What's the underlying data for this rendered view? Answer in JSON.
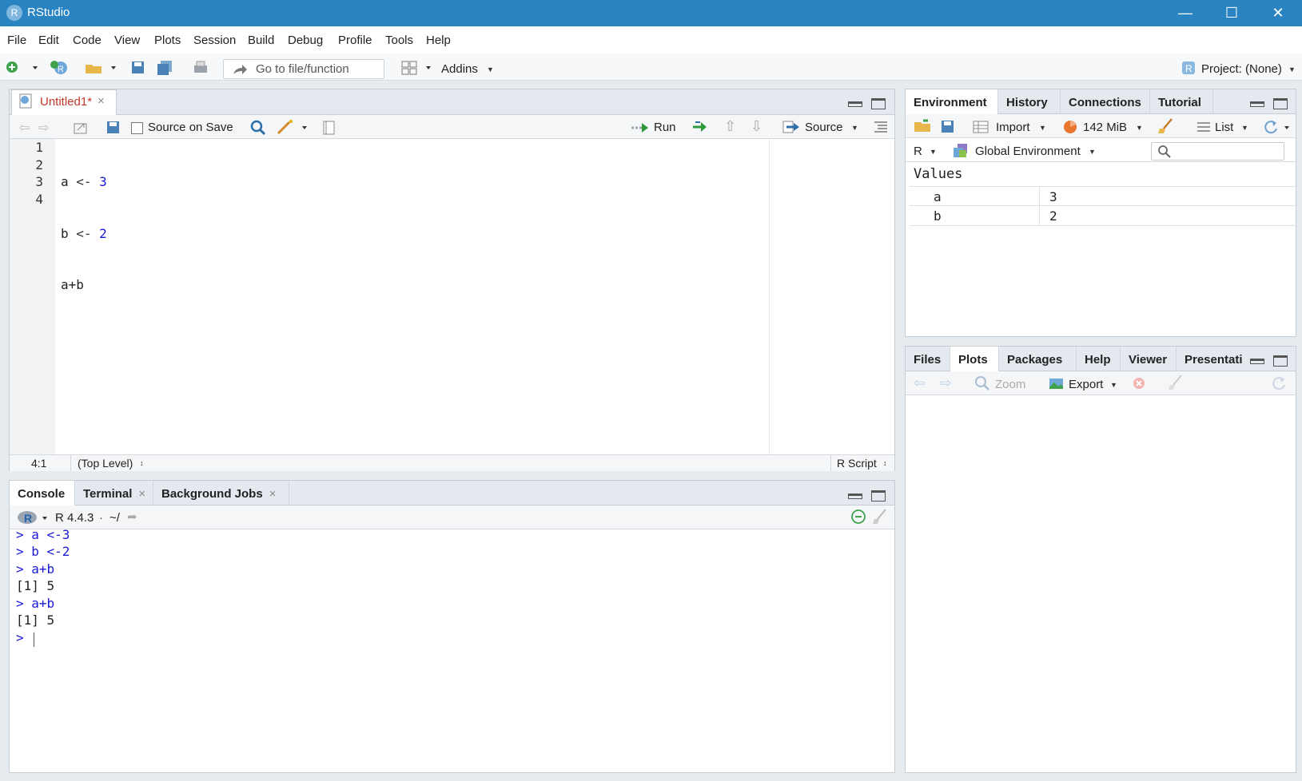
{
  "window": {
    "title": "RStudio",
    "logo": "R"
  },
  "menu": [
    "File",
    "Edit",
    "Code",
    "View",
    "Plots",
    "Session",
    "Build",
    "Debug",
    "Profile",
    "Tools",
    "Help"
  ],
  "toolbar": {
    "goto_placeholder": "Go to file/function",
    "addins": "Addins",
    "project": "Project: (None)"
  },
  "editor": {
    "tab_label": "Untitled1*",
    "source_on_save": "Source on Save",
    "run": "Run",
    "source": "Source",
    "lines": [
      {
        "num": "1",
        "text": "a <- 3"
      },
      {
        "num": "2",
        "text": "b <- 2"
      },
      {
        "num": "3",
        "text": "a+b"
      },
      {
        "num": "4",
        "text": ""
      }
    ],
    "status_pos": "4:1",
    "status_level": "(Top Level)",
    "status_type": "R Script"
  },
  "console": {
    "tabs": [
      "Console",
      "Terminal",
      "Background Jobs"
    ],
    "version": "R 4.4.3",
    "path": "~/",
    "lines": [
      {
        "text": "> a <-3",
        "kind": "input"
      },
      {
        "text": "> b <-2",
        "kind": "input"
      },
      {
        "text": "> a+b",
        "kind": "input"
      },
      {
        "text": "[1] 5",
        "kind": "output"
      },
      {
        "text": "> a+b",
        "kind": "input"
      },
      {
        "text": "[1] 5",
        "kind": "output"
      },
      {
        "text": "> ",
        "kind": "input"
      }
    ]
  },
  "environment": {
    "tabs": [
      "Environment",
      "History",
      "Connections",
      "Tutorial"
    ],
    "import": "Import",
    "memory": "142 MiB",
    "list": "List",
    "lang": "R",
    "scope": "Global Environment",
    "section": "Values",
    "rows": [
      {
        "name": "a",
        "value": "3"
      },
      {
        "name": "b",
        "value": "2"
      }
    ]
  },
  "files": {
    "tabs": [
      "Files",
      "Plots",
      "Packages",
      "Help",
      "Viewer",
      "Presentati"
    ],
    "zoom": "Zoom",
    "export": "Export"
  },
  "colors": {
    "titlebar": "#2a84c2",
    "tab_bg": "#e3e9ef",
    "console_input": "#1a1ad6"
  }
}
